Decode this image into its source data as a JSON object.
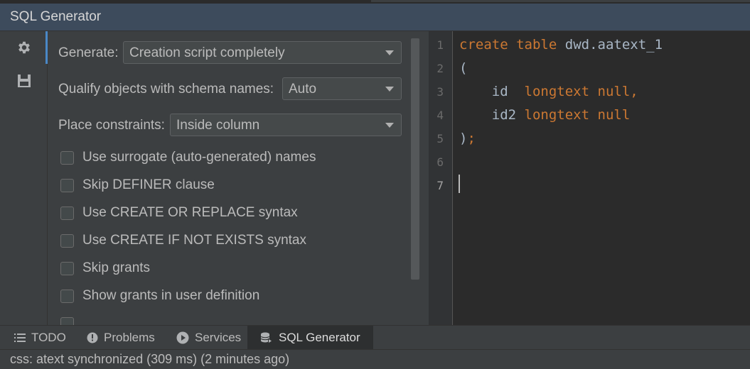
{
  "window": {
    "title": "SQL Generator"
  },
  "sidebar": {
    "items": [
      {
        "icon": "gear-icon"
      },
      {
        "icon": "save-icon"
      }
    ]
  },
  "options": {
    "generate": {
      "label": "Generate:",
      "value": "Creation script completely"
    },
    "qualify": {
      "label": "Qualify objects with schema names:",
      "value": "Auto"
    },
    "constraints": {
      "label": "Place constraints:",
      "value": "Inside column"
    },
    "checkboxes": [
      {
        "label": "Use surrogate (auto-generated) names",
        "checked": false
      },
      {
        "label": "Skip DEFINER clause",
        "checked": false
      },
      {
        "label": "Use CREATE OR REPLACE syntax",
        "checked": false
      },
      {
        "label": "Use CREATE IF NOT EXISTS syntax",
        "checked": false
      },
      {
        "label": "Skip grants",
        "checked": false
      },
      {
        "label": "Show grants in user definition",
        "checked": false
      }
    ]
  },
  "editor": {
    "line_numbers": [
      "1",
      "2",
      "3",
      "4",
      "5",
      "6",
      "7"
    ],
    "lines": [
      {
        "kw1": "create",
        "kw2": "table",
        "name": "dwd.aatext_1"
      },
      {
        "text": "("
      },
      {
        "col": "id",
        "type": "longtext",
        "rest": "null,",
        "kw_color": "#cc7832"
      },
      {
        "col": "id2",
        "type": "longtext",
        "rest": "null"
      },
      {
        "paren": ")",
        "semi": ";"
      }
    ]
  },
  "toolwindow": {
    "tabs": [
      {
        "label": "TODO",
        "icon": "list-icon"
      },
      {
        "label": "Problems",
        "icon": "info-icon"
      },
      {
        "label": "Services",
        "icon": "play-icon"
      },
      {
        "label": "SQL Generator",
        "icon": "database-icon",
        "active": true
      }
    ]
  },
  "status": {
    "text": "css: atext synchronized (309 ms) (2 minutes ago)"
  }
}
